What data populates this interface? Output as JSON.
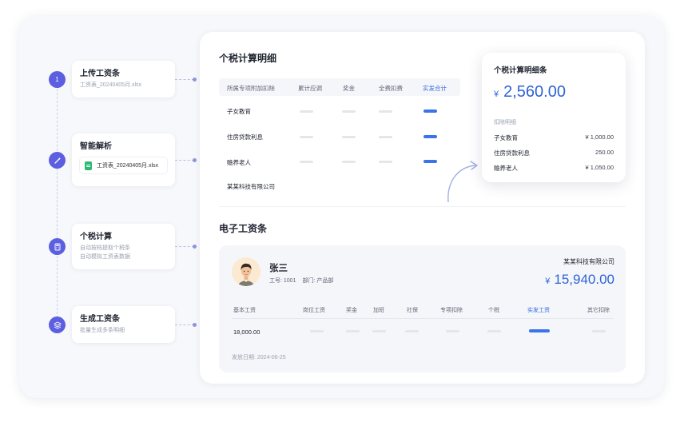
{
  "steps": [
    {
      "num": "1",
      "title": "上传工资条",
      "sub": "工资表_20240405月.xlsx",
      "icon": "number-badge"
    },
    {
      "title": "智能解析",
      "file_chip": "工资表_20240405月.xlsx",
      "icon": "magic-wand-icon"
    },
    {
      "title": "个税计算",
      "sub1": "自动按档提取个税条",
      "sub2": "自动模拟工资表数据",
      "icon": "calculator-icon"
    },
    {
      "title": "生成工资条",
      "sub": "批量生成多条明细",
      "icon": "layers-icon"
    }
  ],
  "tax_detail": {
    "title": "个税计算明细",
    "headers": [
      "所属专项附加扣除",
      "累计应调",
      "奖金",
      "全费扣费",
      "实发合计"
    ],
    "rows": [
      "子女教育",
      "住房贷款利息",
      "赡养老人",
      "某某科技有限公司"
    ]
  },
  "tax_card": {
    "title": "个税计算明细条",
    "currency": "¥",
    "amount": "2,560.00",
    "sub_label": "扣除明细",
    "items": [
      {
        "label": "子女教育",
        "value": "¥ 1,000.00"
      },
      {
        "label": "住房贷款利息",
        "value": "250.00"
      },
      {
        "label": "赡养老人",
        "value": "¥ 1,050.00"
      }
    ]
  },
  "payslip": {
    "title": "电子工资条",
    "name": "张三",
    "emp_id": "工号: 1001",
    "dept": "部门: 产品部",
    "company": "某某科技有限公司",
    "currency": "¥",
    "net": "15,940.00",
    "headers": [
      "基本工资",
      "岗位工资",
      "奖金",
      "加班",
      "社保",
      "专项扣除",
      "个税",
      "实发工资",
      "其它扣除"
    ],
    "base_value": "18,000.00",
    "pay_date": "发放日期: 2024-06-25"
  },
  "colors": {
    "accent": "#3569e0",
    "step": "#5b5fe0"
  }
}
